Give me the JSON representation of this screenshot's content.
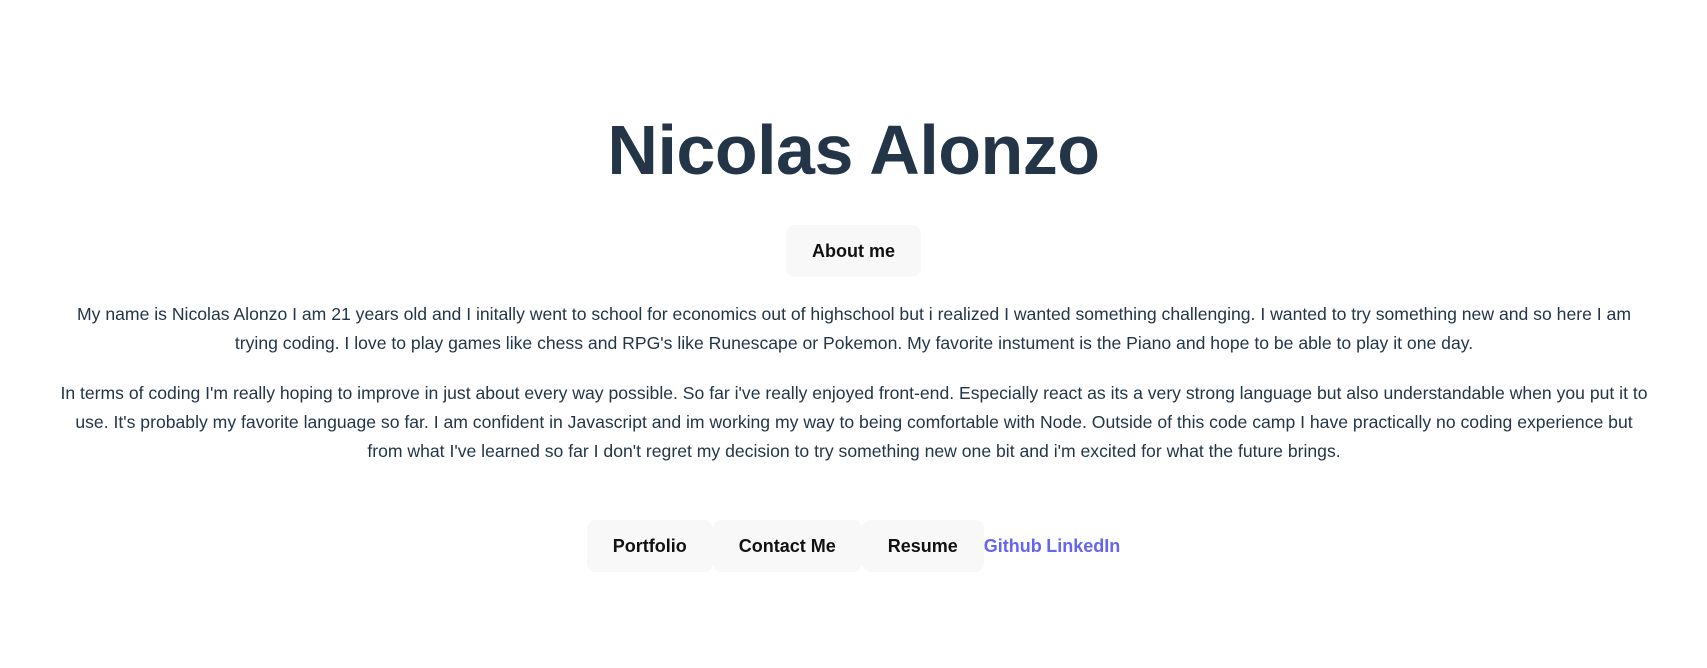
{
  "header": {
    "title": "Nicolas Alonzo",
    "about_label": "About me"
  },
  "about": {
    "paragraphs": [
      "My name is Nicolas Alonzo I am 21 years old and I initally went to school for economics out of highschool but i realized I wanted something challenging. I wanted to try something new and so here I am trying coding. I love to play games like chess and RPG's like Runescape or Pokemon. My favorite instument is the Piano and hope to be able to play it one day.",
      "In terms of coding I'm really hoping to improve in just about every way possible. So far i've really enjoyed front-end. Especially react as its a very strong language but also understandable when you put it to use. It's probably my favorite language so far. I am confident in Javascript and im working my way to being comfortable with Node. Outside of this code camp I have practically no coding experience but from what I've learned so far I don't regret my decision to try something new one bit and i'm excited for what the future brings."
    ]
  },
  "nav": {
    "portfolio": "Portfolio",
    "contact": "Contact Me",
    "resume": "Resume",
    "github": "Github",
    "linkedin": "LinkedIn"
  },
  "colors": {
    "title": "#233547",
    "link": "#6366f1",
    "button_bg": "#f8f8f8"
  }
}
